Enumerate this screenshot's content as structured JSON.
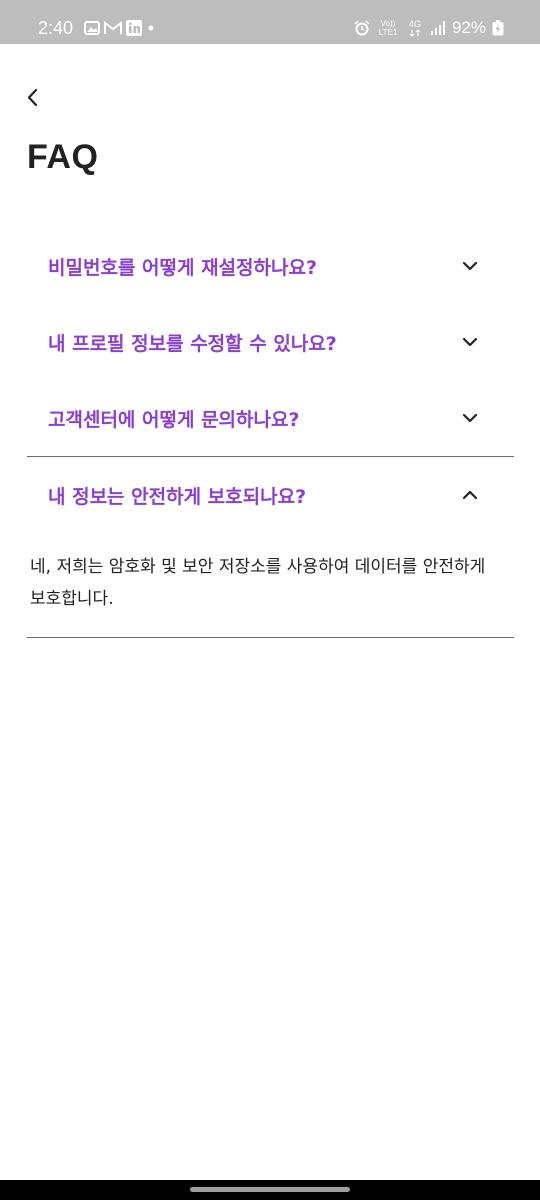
{
  "status_bar": {
    "time": "2:40",
    "battery": "92%",
    "network": "4G",
    "volte": "Vo))",
    "lte": "LTE1",
    "left_icons": [
      "gallery-icon",
      "gmail-icon",
      "linkedin-icon",
      "dot-icon"
    ],
    "right_icons": [
      "alarm-icon",
      "volte-icon",
      "network-4g-icon",
      "signal-icon",
      "battery-icon"
    ]
  },
  "header": {
    "back_icon": "chevron-left-icon",
    "title": "FAQ"
  },
  "faq": {
    "items": [
      {
        "question": "비밀번호를 어떻게 재설정하나요?",
        "expanded": false
      },
      {
        "question": "내 프로필 정보를 수정할 수 있나요?",
        "expanded": false
      },
      {
        "question": "고객센터에 어떻게 문의하나요?",
        "expanded": false
      },
      {
        "question": "내 정보는 안전하게 보호되나요?",
        "expanded": true,
        "answer": "네, 저희는 암호화 및 보안 저장소를 사용하여 데이터를 안전하게 보호합니다."
      }
    ]
  },
  "colors": {
    "status_bar": "#bdbdbd",
    "question": "#8a3fd1",
    "title": "#222222",
    "divider": "#6e6e6e",
    "background": "#ffffff"
  }
}
